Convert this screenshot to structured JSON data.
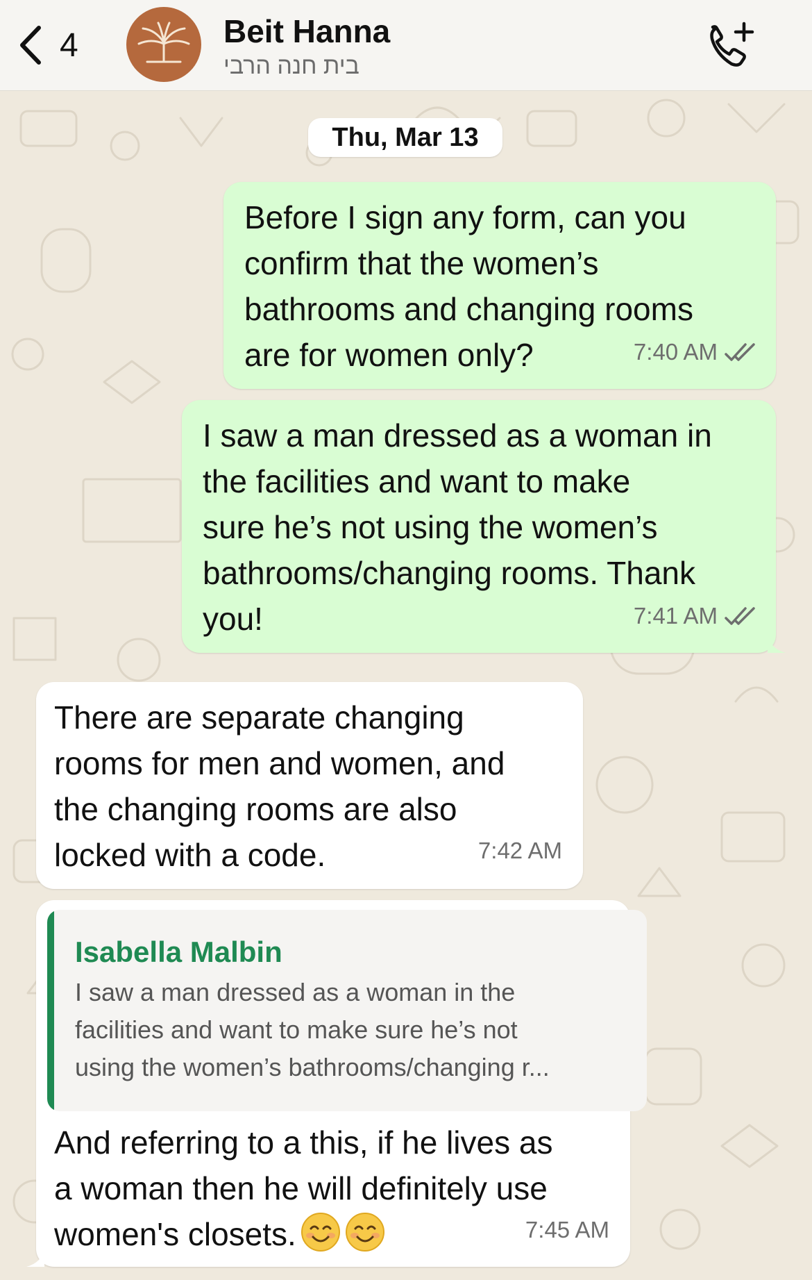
{
  "header": {
    "back_count": "4",
    "contact_name": "Beit Hanna",
    "contact_subtitle": "בית חנה הרבי"
  },
  "chat": {
    "date_label": "Thu, Mar 13",
    "messages": [
      {
        "direction": "outgoing",
        "text": "Before I sign any form, can you\nconfirm that the women’s\nbathrooms and changing rooms\nare for women only?",
        "time": "7:40 AM",
        "status": "read"
      },
      {
        "direction": "outgoing",
        "text": "I saw a man dressed as a woman in\nthe facilities and want to make\nsure he’s not using the women’s\nbathrooms/changing rooms. Thank\nyou!",
        "time": "7:41 AM",
        "status": "read"
      },
      {
        "direction": "incoming",
        "text": "There are separate changing\nrooms for men and women, and\nthe changing rooms are also\nlocked with a code.",
        "time": "7:42 AM"
      },
      {
        "direction": "incoming",
        "quote": {
          "author": "Isabella Malbin",
          "text": "I saw a man dressed as a woman in the\nfacilities and want to make sure he’s not\nusing the women’s bathrooms/changing r..."
        },
        "text": "And referring to a this, if he lives as\na woman then he will definitely use\nwomen's closets.",
        "emojis": [
          "😊",
          "😊"
        ],
        "time": "7:45 AM"
      }
    ]
  },
  "colors": {
    "outgoing_bubble": "#d9fdd3",
    "incoming_bubble": "#ffffff",
    "quote_accent": "#1f8a53",
    "avatar_bg": "#b5693d"
  },
  "icons": [
    "chevron-left-icon",
    "add-call-icon",
    "double-check-icon",
    "smiling-face-icon"
  ]
}
